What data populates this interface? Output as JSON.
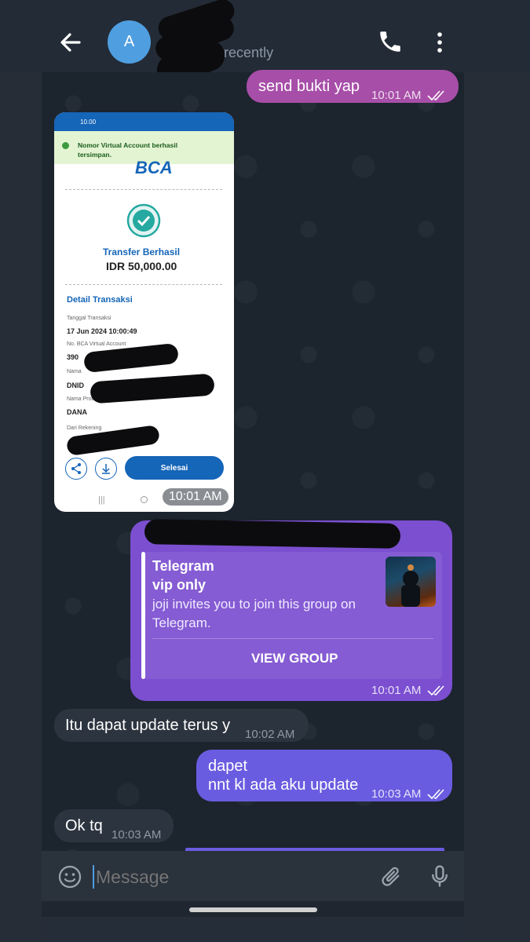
{
  "header": {
    "avatar_letter": "A",
    "status": "last seen recently"
  },
  "messages": [
    {
      "text": "send bukti yap",
      "time": "10:01 AM"
    },
    {
      "time": "10:01 AM"
    },
    {
      "link_title": "Telegram",
      "link_subtitle": "vip only",
      "link_description": "joji invites you to join this group on Telegram.",
      "button": "VIEW GROUP",
      "time": "10:01 AM"
    },
    {
      "text": "Itu dapat update terus y",
      "time": "10:02 AM"
    },
    {
      "line1": "dapet",
      "line2": "nnt kl ada aku update",
      "time": "10:03 AM"
    },
    {
      "text": "Ok tq",
      "time": "10:03 AM"
    }
  ],
  "receipt": {
    "status_time": "10.00",
    "toast": "Nomor Virtual Account berhasil tersimpan.",
    "bank": "BCA",
    "title": "Transfer Berhasil",
    "amount": "IDR 50,000.00",
    "section": "Detail Transaksi",
    "date_label": "Tanggal Transaksi",
    "date": "17 Jun 2024 10:00:49",
    "va_label": "No. BCA Virtual Account",
    "va_partial": "390",
    "name_label": "Nama",
    "name_partial": "DNID",
    "product_label": "Nama Produk",
    "product": "DANA",
    "from_label": "Dari Rekening",
    "button": "Selesai"
  },
  "composer": {
    "placeholder": "Message"
  },
  "colors": {
    "outgoing_pink": "#a74ea8",
    "outgoing_purple": "#7b4fd0",
    "outgoing_violet": "#6a5ce0",
    "incoming": "#2c343f",
    "bca_blue": "#1565b8"
  }
}
